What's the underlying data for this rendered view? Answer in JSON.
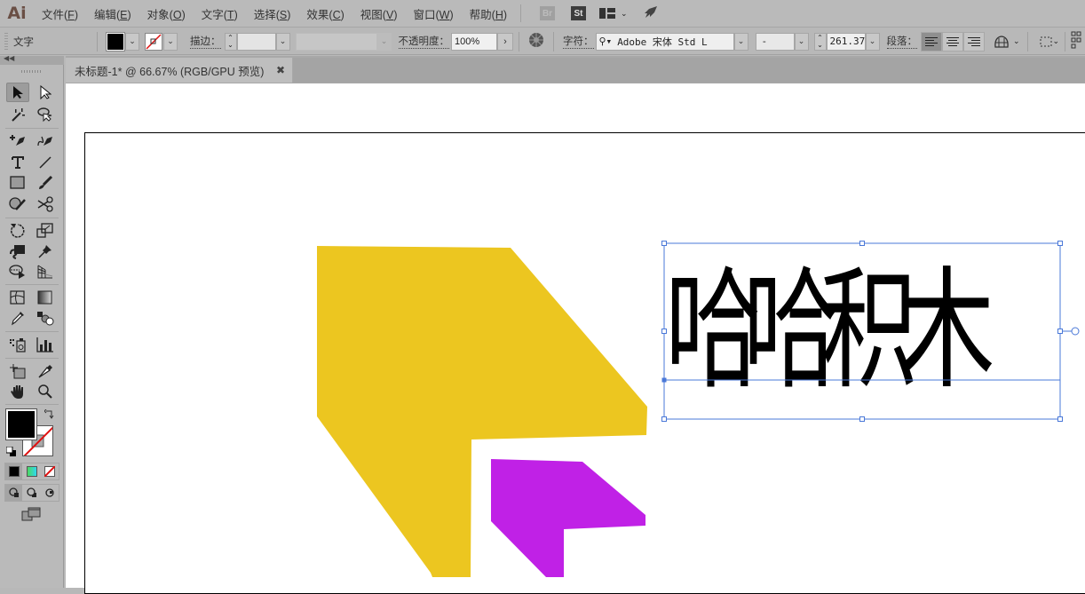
{
  "app": {
    "logo": "Ai"
  },
  "menu": {
    "items": [
      {
        "label": "文件(",
        "key": "F",
        "end": ")"
      },
      {
        "label": "编辑(",
        "key": "E",
        "end": ")"
      },
      {
        "label": "对象(",
        "key": "O",
        "end": ")"
      },
      {
        "label": "文字(",
        "key": "T",
        "end": ")"
      },
      {
        "label": "选择(",
        "key": "S",
        "end": ")"
      },
      {
        "label": "效果(",
        "key": "C",
        "end": ")"
      },
      {
        "label": "视图(",
        "key": "V",
        "end": ")"
      },
      {
        "label": "窗口(",
        "key": "W",
        "end": ")"
      },
      {
        "label": "帮助(",
        "key": "H",
        "end": ")"
      }
    ],
    "bridge_badge": "Br",
    "stock_badge": "St"
  },
  "control_bar": {
    "context_label": "文字",
    "stroke_label": "描边：",
    "stroke_value": "",
    "opacity_label": "不透明度：",
    "opacity_value": "100%",
    "character_label": "字符：",
    "font_family": "Adobe 宋体 Std L",
    "font_style": "-",
    "font_size": "261.37",
    "paragraph_label": "段落："
  },
  "document": {
    "tab_title": "未标题-1* @ 66.67% (RGB/GPU 预览)",
    "close_glyph": "✖"
  },
  "artwork": {
    "text_content": "哈哈积木",
    "yellow_shape_color": "#ecc620",
    "purple_shape_color": "#c021e6",
    "selection_color": "#4a78d8"
  },
  "swatches": {
    "fill_color": "#000000",
    "stroke_color": "none"
  }
}
